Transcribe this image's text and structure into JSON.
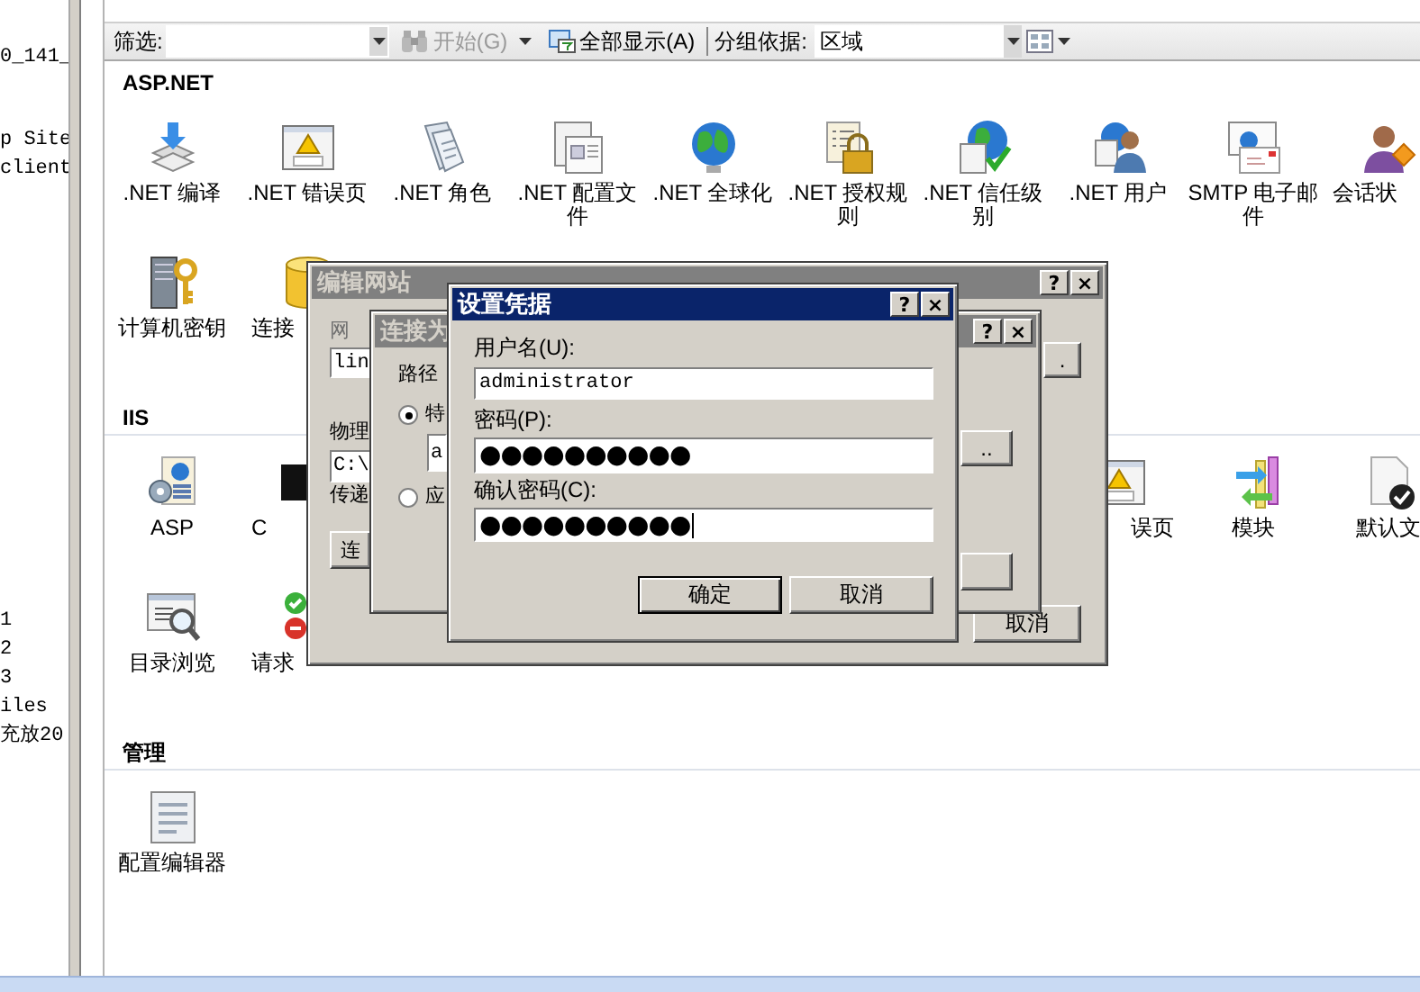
{
  "tree": {
    "groups": [
      [
        "0_141_"
      ],
      [
        "p Site",
        "client"
      ],
      [
        "1",
        "2",
        "3",
        "iles",
        "充放20"
      ]
    ]
  },
  "toolbar": {
    "filter_label": "筛选:",
    "start_button": {
      "label": "开始(G)",
      "disabled": true
    },
    "show_all_button": {
      "label": "全部显示(A)"
    },
    "group_by_label": "分组依据:",
    "group_by_select": {
      "value": "区域"
    }
  },
  "sections": [
    {
      "title": "ASP.NET",
      "rows": [
        {
          "items": [
            {
              "label": ".NET 编译"
            },
            {
              "label": ".NET 错误页"
            },
            {
              "label": ".NET 角色"
            },
            {
              "label": ".NET 配置文件"
            },
            {
              "label": ".NET 全球化"
            },
            {
              "label": ".NET 授权规则"
            },
            {
              "label": ".NET 信任级别"
            },
            {
              "label": ".NET 用户"
            },
            {
              "label": "SMTP 电子邮件"
            },
            {
              "label": "会话状"
            }
          ]
        },
        {
          "items": [
            {
              "label": "计算机密钥"
            },
            {
              "label": "连接"
            }
          ]
        }
      ]
    },
    {
      "title": "IIS",
      "rows": [
        {
          "items": [
            {
              "label": "ASP"
            },
            {
              "label": "C"
            }
          ],
          "items_right": [
            {
              "label": "误页"
            },
            {
              "label": "模块"
            },
            {
              "label": "默认文"
            }
          ]
        },
        {
          "items": [
            {
              "label": "目录浏览"
            },
            {
              "label": "请求"
            }
          ]
        }
      ]
    },
    {
      "title": "管理",
      "rows": [
        {
          "items": [
            {
              "label": "配置编辑器"
            }
          ]
        }
      ]
    }
  ],
  "edit_site_dialog": {
    "title": "编辑网站",
    "active": false,
    "help_button": "?",
    "close_button": "×",
    "site_label": "网",
    "site_field": {
      "value": "lin"
    },
    "browse_button": ".",
    "path_label": "物理",
    "path_field": {
      "value": "C:\\"
    },
    "pass_label": "传递",
    "connect_button": "连",
    "cancel_button": "取消"
  },
  "connect_as_dialog": {
    "title": "连接为",
    "active": false,
    "help_button": "?",
    "close_button": "×",
    "path_label": "路径",
    "options": [
      {
        "label": "特",
        "selected": true
      },
      {
        "label": "应",
        "selected": false
      }
    ],
    "user_field": {
      "value": "a"
    },
    "browse_button": ".."
  },
  "credentials_dialog": {
    "title": "设置凭据",
    "active": true,
    "help_button": "?",
    "close_button": "×",
    "fields": [
      {
        "label": "用户名(U):",
        "value": "administrator",
        "focused": false
      },
      {
        "label": "密码(P):",
        "value": "●●●●●●●●●●",
        "focused": false
      },
      {
        "label": "确认密码(C):",
        "value": "●●●●●●●●●●",
        "focused": true
      }
    ],
    "buttons": [
      {
        "label": "确定",
        "default": true
      },
      {
        "label": "取消",
        "default": false
      }
    ]
  }
}
